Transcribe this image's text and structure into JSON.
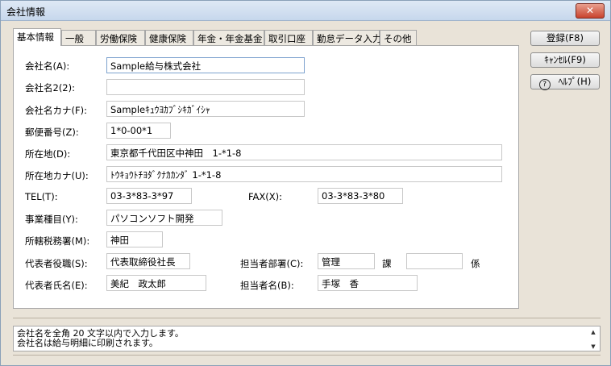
{
  "window": {
    "title": "会社情報",
    "close_symbol": "✕"
  },
  "tabs": [
    {
      "label": "基本情報",
      "active": true
    },
    {
      "label": "一般"
    },
    {
      "label": "労働保険"
    },
    {
      "label": "健康保険"
    },
    {
      "label": "年金・年金基金"
    },
    {
      "label": "取引口座"
    },
    {
      "label": "勤怠データ入力"
    },
    {
      "label": "その他"
    }
  ],
  "form": {
    "company_name": {
      "label": "会社名(A):",
      "value": "Sample給与株式会社"
    },
    "company_name2": {
      "label": "会社名2(2):",
      "value": ""
    },
    "company_name_kana": {
      "label": "会社名カナ(F):",
      "value": "Sampleｷｭｳﾖｶﾌﾞｼｷｶﾞｲｼｬ"
    },
    "postal_code": {
      "label": "郵便番号(Z):",
      "value": "1*0-00*1"
    },
    "address": {
      "label": "所在地(D):",
      "value": "東京都千代田区中神田　1-*1-8"
    },
    "address_kana": {
      "label": "所在地カナ(U):",
      "value": "ﾄｳｷｮｳﾄﾁﾖﾀﾞｸﾅｶｶﾝﾀﾞ 1-*1-8"
    },
    "tel": {
      "label": "TEL(T):",
      "value": "03-3*83-3*97"
    },
    "fax": {
      "label": "FAX(X):",
      "value": "03-3*83-3*80"
    },
    "business_type": {
      "label": "事業種目(Y):",
      "value": "パソコンソフト開発"
    },
    "tax_office": {
      "label": "所轄税務署(M):",
      "value": "神田"
    },
    "rep_title": {
      "label": "代表者役職(S):",
      "value": "代表取締役社長"
    },
    "dept": {
      "label": "担当者部署(C):",
      "value": "管理",
      "ka": "課",
      "kakari": "係",
      "kakari_value": ""
    },
    "rep_name": {
      "label": "代表者氏名(E):",
      "value": "美紀　政太郎"
    },
    "person_name": {
      "label": "担当者名(B):",
      "value": "手塚　香"
    }
  },
  "buttons": {
    "register": "登録(F8)",
    "cancel": "ｷｬﾝｾﾙ(F9)",
    "help": "ﾍﾙﾌﾟ(H)",
    "help_icon": "?"
  },
  "status": {
    "line1": "会社名を全角 20 文字以内で入力します。",
    "line2": "会社名は給与明細に印刷されます。",
    "scroll_up": "▲",
    "scroll_down": "▼"
  }
}
